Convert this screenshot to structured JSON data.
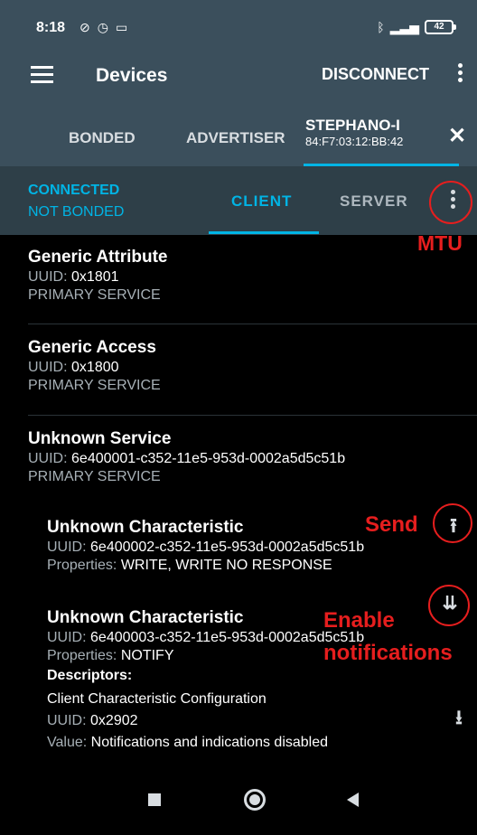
{
  "status_bar": {
    "time": "8:18",
    "left_icons": [
      "no-alarm-icon",
      "alarm-icon",
      "screen-icon"
    ],
    "right_icons": [
      "bluetooth-icon",
      "signal-icon"
    ],
    "battery": "42"
  },
  "app_bar": {
    "title": "Devices",
    "disconnect_label": "DISCONNECT"
  },
  "device_tabs": {
    "bonded": "BONDED",
    "advertiser": "ADVERTISER",
    "device_name": "STEPHANO-I",
    "device_mac": "84:F7:03:12:BB:42"
  },
  "connection": {
    "state": "CONNECTED",
    "bond_state": "NOT BONDED",
    "client_tab": "CLIENT",
    "server_tab": "SERVER"
  },
  "annotations": {
    "mtu": "MTU",
    "send": "Send",
    "enable_line1": "Enable",
    "enable_line2": "notifications"
  },
  "services": [
    {
      "title": "Generic Attribute",
      "uuid_label": "UUID:",
      "uuid": "0x1801",
      "type": "PRIMARY SERVICE"
    },
    {
      "title": "Generic Access",
      "uuid_label": "UUID:",
      "uuid": "0x1800",
      "type": "PRIMARY SERVICE"
    },
    {
      "title": "Unknown Service",
      "uuid_label": "UUID:",
      "uuid": "6e400001-c352-11e5-953d-0002a5d5c51b",
      "type": "PRIMARY SERVICE"
    }
  ],
  "characteristics": [
    {
      "title": "Unknown Characteristic",
      "uuid_label": "UUID:",
      "uuid": "6e400002-c352-11e5-953d-0002a5d5c51b",
      "props_label": "Properties:",
      "props": "WRITE, WRITE NO RESPONSE"
    },
    {
      "title": "Unknown Characteristic",
      "uuid_label": "UUID:",
      "uuid": "6e400003-c352-11e5-953d-0002a5d5c51b",
      "props_label": "Properties:",
      "props": "NOTIFY",
      "descriptors_label": "Descriptors:",
      "descriptor_name": "Client Characteristic Configuration",
      "descriptor_uuid_label": "UUID:",
      "descriptor_uuid": "0x2902",
      "value_label": "Value:",
      "value": "Notifications and indications disabled"
    }
  ],
  "colors": {
    "app_bar": "#3b4f5c",
    "accent": "#00b4e5",
    "annotation": "#e61e1e"
  }
}
